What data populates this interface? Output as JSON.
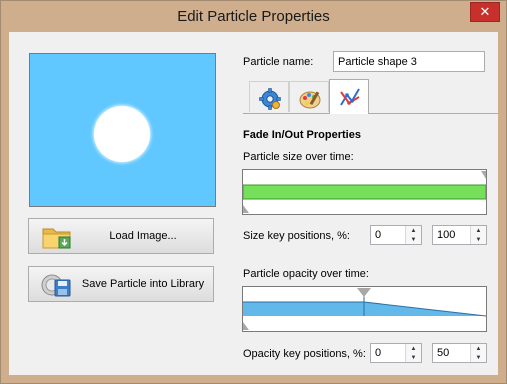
{
  "window": {
    "title": "Edit Particle Properties",
    "close_glyph": "✕"
  },
  "left": {
    "load_image_label": "Load Image...",
    "save_library_label": "Save Particle into Library"
  },
  "name_field": {
    "label": "Particle name:",
    "value": "Particle shape 3"
  },
  "tabs": [
    {
      "icon": "gear-icon",
      "active": false
    },
    {
      "icon": "palette-icon",
      "active": false
    },
    {
      "icon": "curve-graph-icon",
      "active": true
    }
  ],
  "fade": {
    "heading": "Fade In/Out Properties",
    "size_label": "Particle size over time:",
    "size_keys_label": "Size key positions, %:",
    "size_key_start": "0",
    "size_key_end": "100",
    "opacity_label": "Particle opacity over time:",
    "opacity_keys_label": "Opacity key positions, %:",
    "opacity_key_start": "0",
    "opacity_key_end": "50"
  },
  "colors": {
    "title_bar": "#ceae8c",
    "close_button": "#c7302b",
    "preview_bg": "#61c8ff",
    "size_curve": "#77e05a",
    "opacity_curve": "#62b8e8"
  }
}
